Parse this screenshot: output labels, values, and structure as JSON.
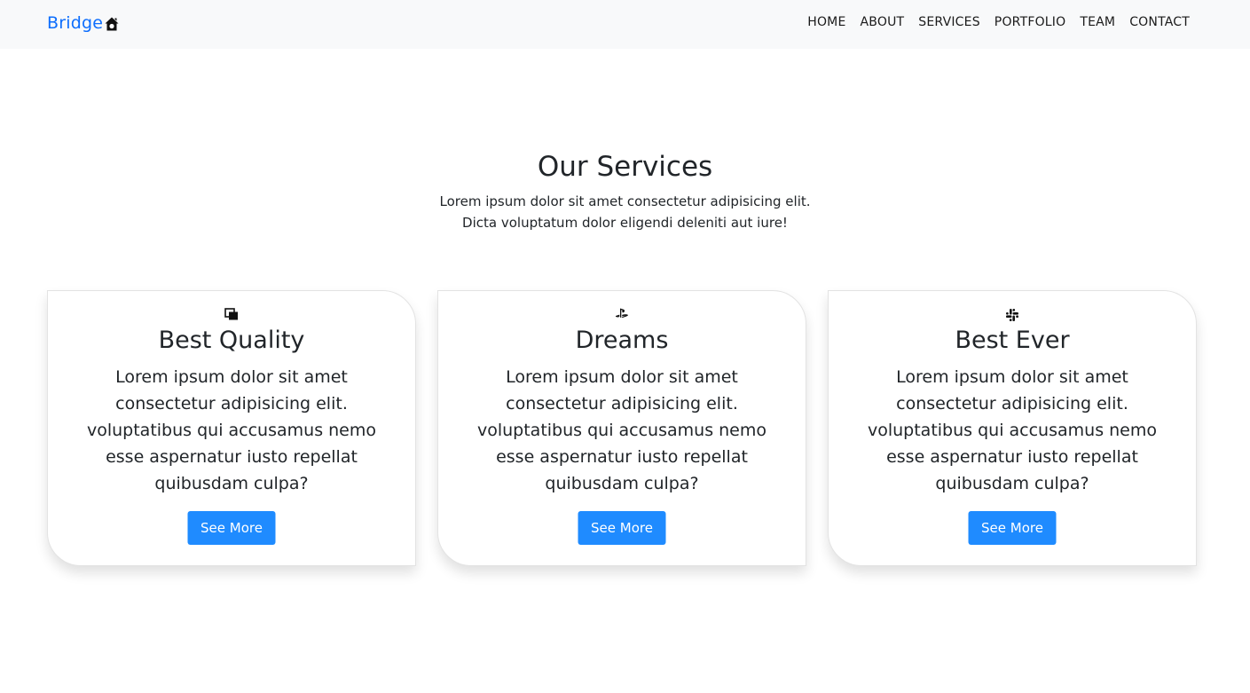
{
  "navbar": {
    "brand": "Bridge",
    "brand_icon": "house-icon",
    "links": [
      "HOME",
      "ABOUT",
      "SERVICES",
      "PORTFOLIO",
      "TEAM",
      "CONTACT"
    ]
  },
  "services": {
    "title": "Our Services",
    "subtitle_lines": [
      "Lorem ipsum dolor sit amet consectetur adipisicing elit.",
      "Dicta voluptatum dolor eligendi deleniti aut iure!"
    ],
    "cards": [
      {
        "icon": "copy-squares-icon",
        "title": "Best Quality",
        "body_lines": [
          "Lorem ipsum dolor sit amet",
          "consectetur adipisicing elit.",
          "voluptatibus qui accusamus nemo",
          "esse aspernatur iusto repellat",
          "quibusdam culpa?"
        ],
        "button": "See More"
      },
      {
        "icon": "playstation-icon",
        "title": "Dreams",
        "body_lines": [
          "Lorem ipsum dolor sit amet",
          "consectetur adipisicing elit.",
          "voluptatibus qui accusamus nemo",
          "esse aspernatur iusto repellat",
          "quibusdam culpa?"
        ],
        "button": "See More"
      },
      {
        "icon": "slack-icon",
        "title": "Best Ever",
        "body_lines": [
          "Lorem ipsum dolor sit amet",
          "consectetur adipisicing elit.",
          "voluptatibus qui accusamus nemo",
          "esse aspernatur iusto repellat",
          "quibusdam culpa?"
        ],
        "button": "See More"
      }
    ]
  },
  "colors": {
    "brand": "#0d6efd",
    "button": "#1f8bff",
    "navbar_bg": "#f8f9fa",
    "text": "#212529"
  }
}
